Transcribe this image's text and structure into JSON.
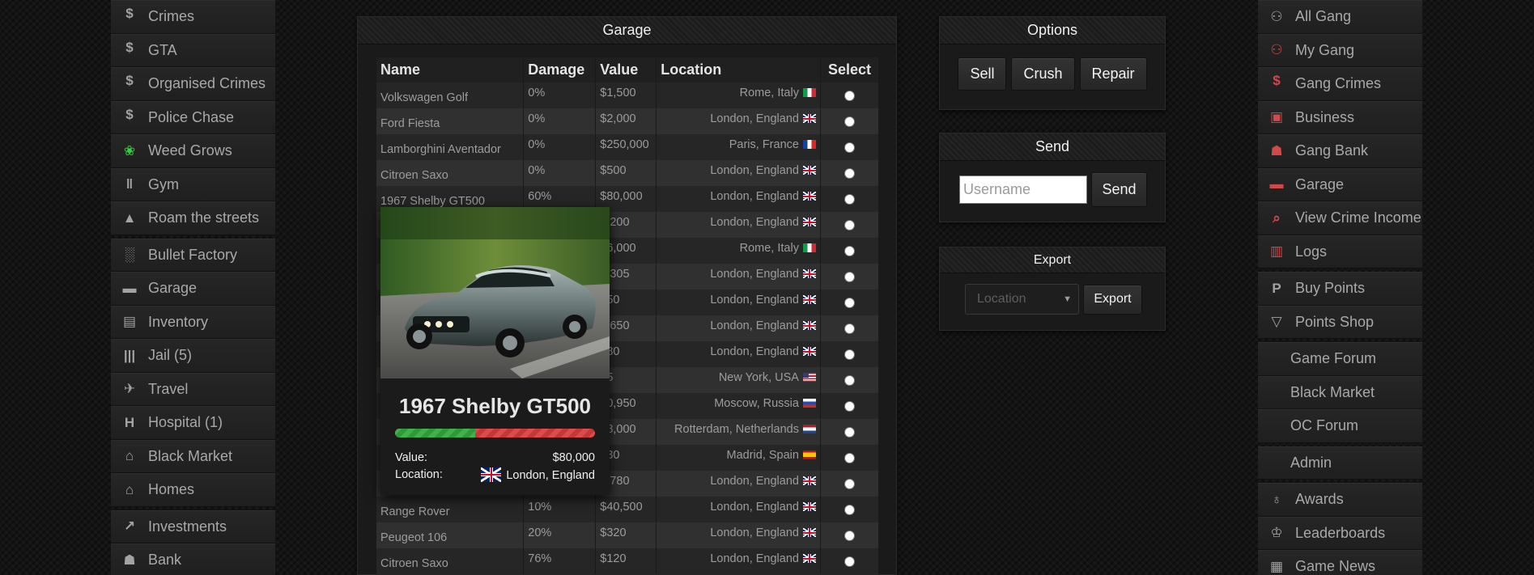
{
  "left_nav": {
    "groups": [
      [
        {
          "id": "crimes",
          "label": "Crimes",
          "icon": "dollar-icon"
        },
        {
          "id": "gta",
          "label": "GTA",
          "icon": "dollar-icon"
        },
        {
          "id": "organised-crimes",
          "label": "Organised Crimes",
          "icon": "dollar-icon"
        },
        {
          "id": "police-chase",
          "label": "Police Chase",
          "icon": "dollar-icon"
        },
        {
          "id": "weed-grows",
          "label": "Weed Grows",
          "icon": "cannabis-leaf-icon"
        },
        {
          "id": "gym",
          "label": "Gym",
          "icon": "dumbbell-icon"
        },
        {
          "id": "roam-the-streets",
          "label": "Roam the streets",
          "icon": "road-icon"
        }
      ],
      [
        {
          "id": "bullet-factory",
          "label": "Bullet Factory",
          "icon": "factory-icon"
        },
        {
          "id": "garage",
          "label": "Garage",
          "icon": "car-icon"
        },
        {
          "id": "inventory",
          "label": "Inventory",
          "icon": "boxes-icon"
        },
        {
          "id": "jail",
          "label": "Jail (5)",
          "icon": "jail-bars-icon"
        },
        {
          "id": "travel",
          "label": "Travel",
          "icon": "plane-icon"
        },
        {
          "id": "hospital",
          "label": "Hospital (1)",
          "icon": "hospital-icon"
        },
        {
          "id": "black-market",
          "label": "Black Market",
          "icon": "store-icon"
        },
        {
          "id": "homes",
          "label": "Homes",
          "icon": "home-icon"
        }
      ],
      [
        {
          "id": "investments",
          "label": "Investments",
          "icon": "chart-line-icon"
        },
        {
          "id": "bank",
          "label": "Bank",
          "icon": "bank-icon"
        }
      ]
    ]
  },
  "right_nav": {
    "groups": [
      [
        {
          "id": "all-gang",
          "label": "All Gang",
          "icon": "users-icon"
        },
        {
          "id": "my-gang",
          "label": "My Gang",
          "icon": "users-icon-red"
        },
        {
          "id": "gang-crimes",
          "label": "Gang Crimes",
          "icon": "dollar-icon-red"
        },
        {
          "id": "business",
          "label": "Business",
          "icon": "truck-icon-red"
        },
        {
          "id": "gang-bank",
          "label": "Gang Bank",
          "icon": "bank-icon-red"
        },
        {
          "id": "garage",
          "label": "Garage",
          "icon": "car-icon-red"
        },
        {
          "id": "view-crime-income",
          "label": "View Crime Income",
          "icon": "search-dollar-icon-red"
        },
        {
          "id": "logs",
          "label": "Logs",
          "icon": "clipboard-icon-red"
        }
      ],
      [
        {
          "id": "buy-points",
          "label": "Buy Points",
          "icon": "paypal-icon"
        },
        {
          "id": "points-shop",
          "label": "Points Shop",
          "icon": "cart-icon"
        }
      ],
      [
        {
          "id": "game-forum",
          "label": "Game Forum",
          "icon": ""
        },
        {
          "id": "black-market",
          "label": "Black Market",
          "icon": ""
        },
        {
          "id": "oc-forum",
          "label": "OC Forum",
          "icon": ""
        }
      ],
      [
        {
          "id": "admin",
          "label": "Admin",
          "icon": ""
        }
      ],
      [
        {
          "id": "awards",
          "label": "Awards",
          "icon": "award-icon"
        },
        {
          "id": "leaderboards",
          "label": "Leaderboards",
          "icon": "trophy-icon"
        },
        {
          "id": "game-news",
          "label": "Game News",
          "icon": "newspaper-icon"
        }
      ]
    ]
  },
  "garage": {
    "title": "Garage",
    "columns": {
      "name": "Name",
      "damage": "Damage",
      "value": "Value",
      "location": "Location",
      "select": "Select"
    },
    "rows": [
      {
        "name": "Volkswagen Golf",
        "damage": "0%",
        "value": "$1,500",
        "location": "Rome, Italy",
        "flag": "it"
      },
      {
        "name": "Ford Fiesta",
        "damage": "0%",
        "value": "$2,000",
        "location": "London, England",
        "flag": "uk"
      },
      {
        "name": "Lamborghini Aventador",
        "damage": "0%",
        "value": "$250,000",
        "location": "Paris, France",
        "flag": "fr"
      },
      {
        "name": "Citroen Saxo",
        "damage": "0%",
        "value": "$500",
        "location": "London, England",
        "flag": "uk"
      },
      {
        "name": "1967 Shelby GT500",
        "damage": "60%",
        "value": "$80,000",
        "location": "London, England",
        "flag": "uk"
      },
      {
        "name": "",
        "damage": "",
        "value": "3,200",
        "location": "London, England",
        "flag": "uk"
      },
      {
        "name": "",
        "damage": "",
        "value": "16,000",
        "location": "Rome, Italy",
        "flag": "it"
      },
      {
        "name": "",
        "damage": "",
        "value": "1,305",
        "location": "London, England",
        "flag": "uk"
      },
      {
        "name": "",
        "damage": "",
        "value": "450",
        "location": "London, England",
        "flag": "uk"
      },
      {
        "name": "",
        "damage": "",
        "value": "1,650",
        "location": "London, England",
        "flag": "uk"
      },
      {
        "name": "",
        "damage": "",
        "value": "180",
        "location": "London, England",
        "flag": "uk"
      },
      {
        "name": "",
        "damage": "",
        "value": "75",
        "location": "New York, USA",
        "flag": "us"
      },
      {
        "name": "",
        "damage": "",
        "value": "40,950",
        "location": "Moscow, Russia",
        "flag": "ru"
      },
      {
        "name": "",
        "damage": "",
        "value": "48,000",
        "location": "Rotterdam, Netherlands",
        "flag": "nl"
      },
      {
        "name": "",
        "damage": "",
        "value": "930",
        "location": "Madrid, Spain",
        "flag": "es"
      },
      {
        "name": "",
        "damage": "",
        "value": "1,780",
        "location": "London, England",
        "flag": "uk"
      },
      {
        "name": "Range Rover",
        "damage": "10%",
        "value": "$40,500",
        "location": "London, England",
        "flag": "uk"
      },
      {
        "name": "Peugeot 106",
        "damage": "20%",
        "value": "$320",
        "location": "London, England",
        "flag": "uk"
      },
      {
        "name": "Citroen Saxo",
        "damage": "76%",
        "value": "$120",
        "location": "London, England",
        "flag": "uk"
      }
    ]
  },
  "tooltip": {
    "title": "1967 Shelby GT500",
    "health_fraction": 0.4,
    "value_label": "Value:",
    "value": "$80,000",
    "location_label": "Location:",
    "location": "London, England",
    "flag": "uk"
  },
  "options": {
    "title": "Options",
    "sell_label": "Sell",
    "crush_label": "Crush",
    "repair_label": "Repair"
  },
  "send": {
    "title": "Send",
    "username_placeholder": "Username",
    "username_value": "",
    "send_label": "Send"
  },
  "export": {
    "title": "Export",
    "location_select": "Location",
    "export_label": "Export"
  },
  "colors": {
    "background": "#141414",
    "panel": "#1a1a1a",
    "health_green": "#3fb24a",
    "damage_red": "#e04a4a",
    "accent_green_icon": "#2fd23a",
    "accent_red_icon": "#d04a4a"
  }
}
